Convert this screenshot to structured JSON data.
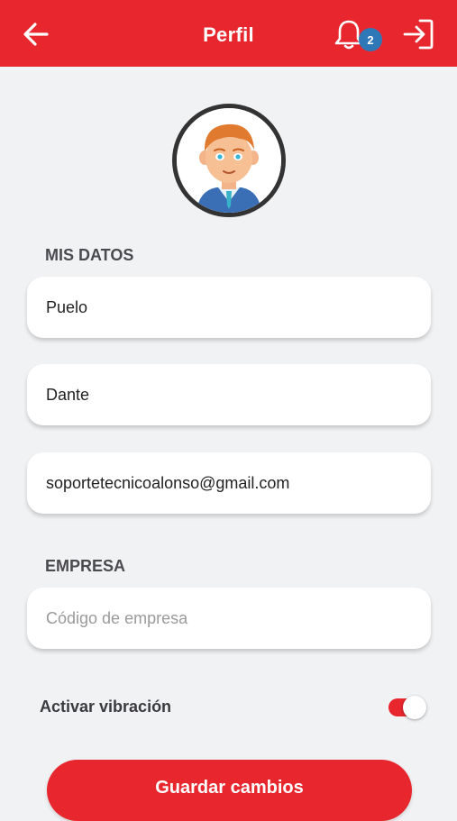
{
  "header": {
    "title": "Perfil",
    "notification_count": "2",
    "back_icon": "arrow-left-icon",
    "bell_icon": "bell-icon",
    "logout_icon": "logout-icon"
  },
  "colors": {
    "brand_red": "#e7262d",
    "badge_blue": "#2f78b7",
    "background": "#f1f2f4"
  },
  "profile": {
    "avatar": "avatar-cartoon-man"
  },
  "mis_datos": {
    "label": "MIS DATOS",
    "last_name": "Puelo",
    "first_name": "Dante",
    "email": "soportetecnicoalonso@gmail.com"
  },
  "empresa": {
    "label": "EMPRESA",
    "code_value": "",
    "code_placeholder": "Código de empresa"
  },
  "vibration": {
    "label": "Activar vibración",
    "enabled": true
  },
  "actions": {
    "save_label": "Guardar cambios"
  }
}
